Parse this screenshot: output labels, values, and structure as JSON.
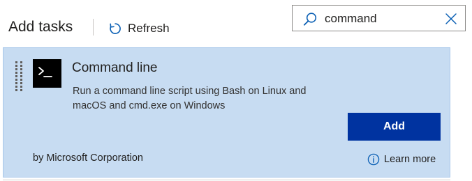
{
  "header": {
    "title": "Add tasks",
    "refresh_label": "Refresh"
  },
  "search": {
    "value": "command",
    "placeholder": ""
  },
  "task": {
    "title": "Command line",
    "description": "Run a command line script using Bash on Linux and macOS and cmd.exe on Windows",
    "add_label": "Add",
    "publisher": "by Microsoft Corporation",
    "learn_more_label": "Learn more",
    "icon": "terminal-icon"
  },
  "colors": {
    "card_background": "#c7dcf2",
    "add_button": "#0033a0",
    "accent": "#0a5fb4"
  }
}
